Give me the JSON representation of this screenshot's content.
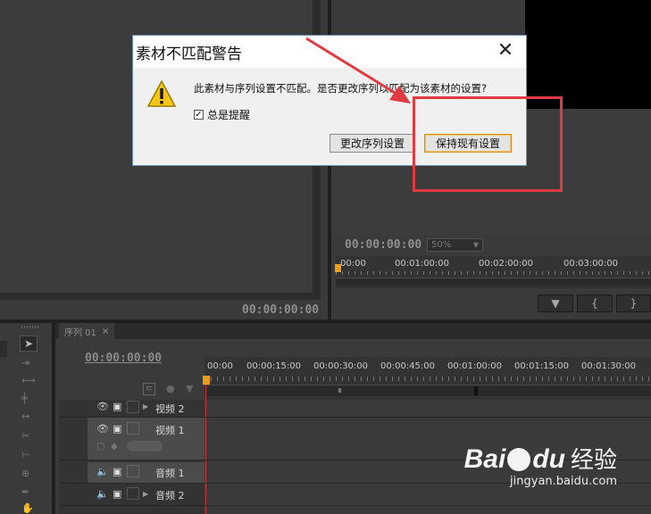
{
  "source_panel": {
    "timecode": "00:00:00:00"
  },
  "program_panel": {
    "timecode": "00:00:00:00",
    "zoom": "50%",
    "ruler": [
      "00:00",
      "00:01:00:00",
      "00:02:00:00",
      "00:03:00:00"
    ]
  },
  "timeline": {
    "tab_label": "序列 01",
    "tab_close": "×",
    "timecode": "00:00:00:00",
    "ruler": [
      "00:00",
      "00:00:15:00",
      "00:00:30:00",
      "00:00:45:00",
      "00:01:00:00",
      "00:01:15:00",
      "00:01:30:00"
    ],
    "tracks": [
      {
        "name": "视频 2"
      },
      {
        "name": "视频 1"
      },
      {
        "name": "音频 1"
      },
      {
        "name": "音频 2"
      }
    ]
  },
  "dialog": {
    "title": "素材不匹配警告",
    "close": "✕",
    "message": "此素材与序列设置不匹配。是否更改序列以匹配为该素材的设置?",
    "checkbox_label": "总是提醒",
    "checkbox_checked": true,
    "change_button": "更改序列设置",
    "keep_button": "保持现有设置",
    "warning_icon": "warning-icon"
  },
  "watermark": {
    "brand": "Bai",
    "brand2": "du",
    "cn": "经验",
    "url": "jingyan.baidu.com"
  }
}
